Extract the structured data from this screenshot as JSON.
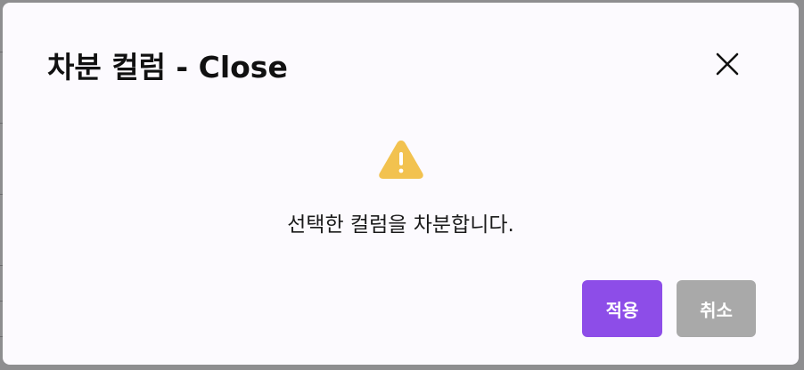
{
  "dialog": {
    "title": "차분 컬럼 - Close",
    "message": "선택한 컬럼을 차분합니다.",
    "close_icon": "close-icon",
    "warning_icon": "warning-triangle-icon",
    "apply_label": "적용",
    "cancel_label": "취소"
  },
  "colors": {
    "apply": "#8d4de8",
    "cancel": "#a9a9a9",
    "warning": "#f2c24f",
    "dialog_bg": "#fcfafe"
  }
}
